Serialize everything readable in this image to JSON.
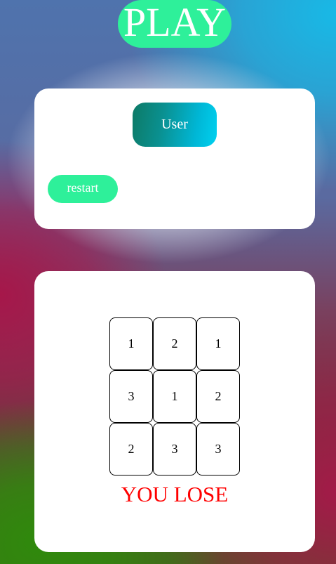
{
  "header": {
    "title": "PLAY"
  },
  "controls": {
    "user_label": "User",
    "restart_label": "restart"
  },
  "board": {
    "cells": [
      "1",
      "2",
      "1",
      "3",
      "1",
      "2",
      "2",
      "3",
      "3"
    ]
  },
  "status": {
    "result": "YOU LOSE"
  },
  "colors": {
    "accent": "#2ef09a",
    "result": "#ff0000",
    "user_gradient_start": "#0d7a66",
    "user_gradient_end": "#00d1f0"
  }
}
